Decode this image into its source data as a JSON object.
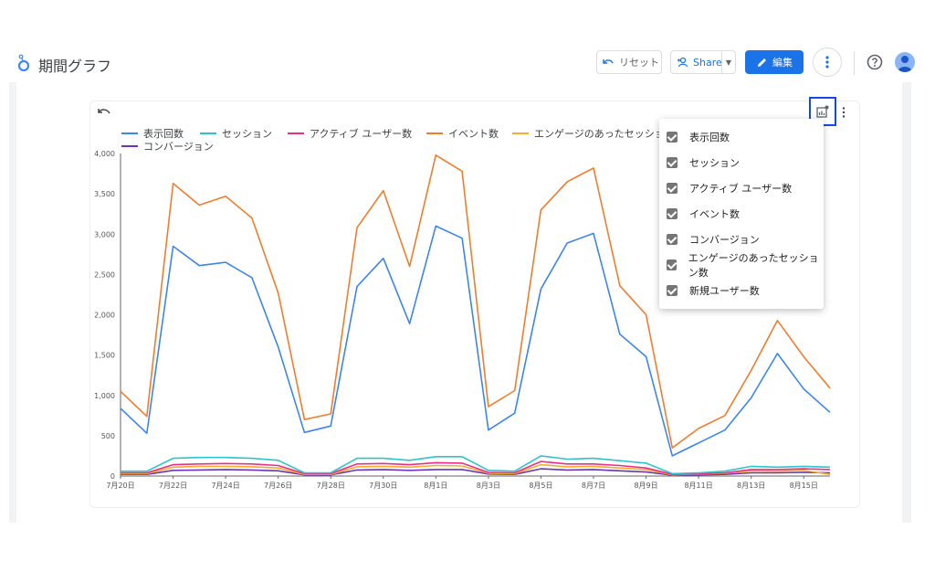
{
  "header": {
    "title": "期間グラフ",
    "reset_label": "リセット",
    "share_label": "Share",
    "edit_label": "編集"
  },
  "legend": [
    {
      "name": "表示回数",
      "color": "#3b86e8"
    },
    {
      "name": "セッション",
      "color": "#2ec4cc"
    },
    {
      "name": "アクティブ ユーザー数",
      "color": "#e8308b"
    },
    {
      "name": "イベント数",
      "color": "#f07c2e"
    },
    {
      "name": "エンゲージのあったセッショ",
      "color": "#f7ac2d"
    },
    {
      "name": "コンバージョン",
      "color": "#6a35b8"
    }
  ],
  "series_menu": {
    "items": [
      "表示回数",
      "セッション",
      "アクティブ ユーザー数",
      "イベント数",
      "コンバージョン",
      "エンゲージのあったセッション数",
      "新規ユーザー数"
    ],
    "checked": [
      true,
      true,
      true,
      true,
      true,
      true,
      true
    ]
  },
  "chart_data": {
    "type": "line",
    "x_tick_labels": [
      "7月20日",
      "7月22日",
      "7月24日",
      "7月26日",
      "7月28日",
      "7月30日",
      "8月1日",
      "8月3日",
      "8月5日",
      "8月7日",
      "8月9日",
      "8月11日",
      "8月13日",
      "8月15日"
    ],
    "y_tick_labels": [
      "0",
      "500",
      "1,000",
      "1,500",
      "2,000",
      "2,500",
      "3,000",
      "3,500",
      "4,000"
    ],
    "ylim": [
      0,
      4000
    ],
    "x": [
      "7月20日",
      "7月21日",
      "7月22日",
      "7月23日",
      "7月24日",
      "7月25日",
      "7月26日",
      "7月27日",
      "7月28日",
      "7月29日",
      "7月30日",
      "7月31日",
      "8月1日",
      "8月2日",
      "8月3日",
      "8月4日",
      "8月5日",
      "8月6日",
      "8月7日",
      "8月8日",
      "8月9日",
      "8月10日",
      "8月11日",
      "8月12日",
      "8月13日",
      "8月14日",
      "8月15日",
      "8月16日"
    ],
    "series": [
      {
        "name": "表示回数",
        "color": "#3b86e8",
        "values": [
          840,
          530,
          2850,
          2610,
          2650,
          2460,
          1600,
          540,
          620,
          2350,
          2700,
          1890,
          3100,
          2950,
          570,
          780,
          2320,
          2890,
          3010,
          1760,
          1480,
          250,
          410,
          570,
          970,
          1520,
          1080,
          790
        ]
      },
      {
        "name": "セッション",
        "color": "#2ec4cc",
        "values": [
          60,
          60,
          220,
          230,
          230,
          220,
          195,
          40,
          40,
          220,
          220,
          195,
          240,
          240,
          70,
          60,
          250,
          210,
          220,
          190,
          160,
          30,
          40,
          60,
          120,
          110,
          120,
          110
        ]
      },
      {
        "name": "アクティブ ユーザー数",
        "color": "#e8308b",
        "values": [
          40,
          40,
          140,
          150,
          155,
          150,
          130,
          30,
          30,
          150,
          155,
          140,
          165,
          160,
          45,
          40,
          180,
          150,
          150,
          130,
          100,
          20,
          30,
          40,
          80,
          80,
          90,
          80
        ]
      },
      {
        "name": "イベント数",
        "color": "#f07c2e",
        "values": [
          1050,
          740,
          3630,
          3360,
          3470,
          3200,
          2270,
          700,
          770,
          3080,
          3540,
          2600,
          3980,
          3780,
          860,
          1060,
          3300,
          3650,
          3820,
          2360,
          2000,
          350,
          590,
          750,
          1310,
          1930,
          1480,
          1090
        ]
      },
      {
        "name": "エンゲージのあったセッショ",
        "color": "#f7ac2d",
        "values": [
          30,
          30,
          110,
          120,
          120,
          115,
          100,
          20,
          20,
          115,
          120,
          110,
          130,
          125,
          35,
          30,
          140,
          115,
          120,
          100,
          80,
          15,
          25,
          35,
          65,
          60,
          70,
          20
        ]
      },
      {
        "name": "コンバージョン",
        "color": "#6a35b8",
        "values": [
          20,
          20,
          70,
          75,
          80,
          75,
          65,
          15,
          15,
          75,
          80,
          70,
          80,
          80,
          25,
          20,
          90,
          75,
          80,
          65,
          50,
          10,
          15,
          20,
          40,
          40,
          45,
          40
        ]
      }
    ]
  }
}
